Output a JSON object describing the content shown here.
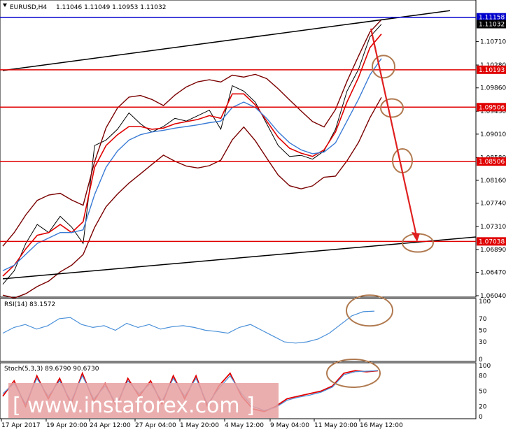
{
  "header": {
    "symbol": "EURUSD,H4",
    "ohlc": "1.11046 1.11049 1.10953 1.11032"
  },
  "colors": {
    "price": "#000000",
    "ma_fast": "#e00000",
    "ma_slow": "#3a7bd5",
    "bollinger": "#7a0000",
    "resistance": "#e00000",
    "top_line": "#0000cc",
    "trend": "#000000",
    "rsi": "#4a90d9",
    "stoch_main": "#e00000",
    "stoch_signal": "#4a90d9",
    "circle": "#b07a50",
    "arrow": "#e02020",
    "watermark_bg": "#e8a0a0"
  },
  "indicators": {
    "rsi_label": "RSI(14) 83.1572",
    "stoch_label": "Stoch(5,3,3) 89.6790 90.6730"
  },
  "watermark": "[ www.instaforex.com ]",
  "chart_data": [
    {
      "type": "line",
      "name": "price",
      "title": "EURUSD,H4",
      "x": [
        "17 Apr 2017",
        "19 Apr 20:00",
        "24 Apr 12:00",
        "27 Apr 04:00",
        "1 May 20:00",
        "4 May 12:00",
        "9 May 04:00",
        "11 May 20:00",
        "16 May 12:00"
      ],
      "yticks": [
        "1.10710",
        "1.10280",
        "1.09860",
        "1.09430",
        "1.09010",
        "1.08580",
        "1.08160",
        "1.07740",
        "1.07310",
        "1.06890",
        "1.06470",
        "1.06040"
      ],
      "ylim": [
        1.0604,
        1.1145
      ],
      "series": [
        {
          "values": [
            1.0625,
            1.065,
            1.07,
            1.0735,
            1.072,
            1.075,
            1.073,
            1.07,
            1.088,
            1.089,
            1.091,
            1.094,
            1.092,
            1.0905,
            1.0915,
            1.093,
            1.0925,
            1.0935,
            1.0945,
            1.091,
            1.099,
            1.098,
            1.096,
            1.092,
            1.088,
            1.086,
            1.0862,
            1.0855,
            1.087,
            1.091,
            1.098,
            1.102,
            1.108,
            1.1103
          ]
        },
        {
          "name": "MA fast",
          "values": [
            1.064,
            1.066,
            1.069,
            1.0715,
            1.072,
            1.0735,
            1.072,
            1.074,
            1.084,
            1.088,
            1.09,
            1.0915,
            1.0915,
            1.091,
            1.0912,
            1.092,
            1.0924,
            1.0928,
            1.0935,
            1.093,
            1.0975,
            1.0975,
            1.0955,
            1.0925,
            1.0895,
            1.0875,
            1.0866,
            1.086,
            1.0872,
            1.0905,
            1.096,
            1.1005,
            1.106,
            1.1085
          ]
        },
        {
          "name": "MA slow",
          "values": [
            1.065,
            1.066,
            1.068,
            1.07,
            1.071,
            1.072,
            1.072,
            1.0725,
            1.079,
            1.084,
            1.087,
            1.089,
            1.09,
            1.0905,
            1.0908,
            1.0912,
            1.0915,
            1.0918,
            1.0922,
            1.0925,
            1.095,
            1.096,
            1.095,
            1.093,
            1.0905,
            1.0885,
            1.0872,
            1.0865,
            1.0868,
            1.0885,
            1.0925,
            1.0965,
            1.101,
            1.104
          ]
        }
      ],
      "levels": [
        "1.11158",
        "1.11032",
        "1.10193",
        "1.09506",
        "1.08506",
        "1.07038"
      ],
      "level_values": [
        1.11158,
        1.11032,
        1.10193,
        1.09506,
        1.08506,
        1.07038
      ]
    },
    {
      "type": "line",
      "name": "rsi",
      "title": "RSI(14) 83.1572",
      "yticks": [
        "100",
        "70",
        "50",
        "30",
        "0"
      ],
      "ylim": [
        0,
        100
      ],
      "values": [
        45,
        55,
        60,
        52,
        58,
        70,
        72,
        60,
        55,
        58,
        50,
        62,
        55,
        60,
        52,
        56,
        58,
        55,
        50,
        48,
        45,
        55,
        60,
        50,
        40,
        30,
        28,
        30,
        35,
        45,
        60,
        75,
        82,
        83
      ]
    },
    {
      "type": "line",
      "name": "stochastic",
      "title": "Stoch(5,3,3) 89.6790 90.6730",
      "yticks": [
        "100",
        "80",
        "50",
        "20",
        "0"
      ],
      "ylim": [
        0,
        100
      ],
      "series": [
        {
          "values": [
            40,
            70,
            20,
            80,
            35,
            75,
            25,
            85,
            30,
            65,
            20,
            75,
            40,
            70,
            25,
            80,
            35,
            80,
            20,
            60,
            85,
            40,
            15,
            10,
            20,
            35,
            40,
            45,
            50,
            60,
            85,
            90,
            88,
            90
          ]
        },
        {
          "values": [
            45,
            65,
            25,
            75,
            40,
            70,
            30,
            80,
            35,
            60,
            25,
            70,
            45,
            65,
            30,
            75,
            40,
            75,
            25,
            55,
            80,
            45,
            20,
            12,
            18,
            32,
            38,
            42,
            48,
            58,
            82,
            88,
            89,
            90
          ]
        }
      ]
    }
  ]
}
